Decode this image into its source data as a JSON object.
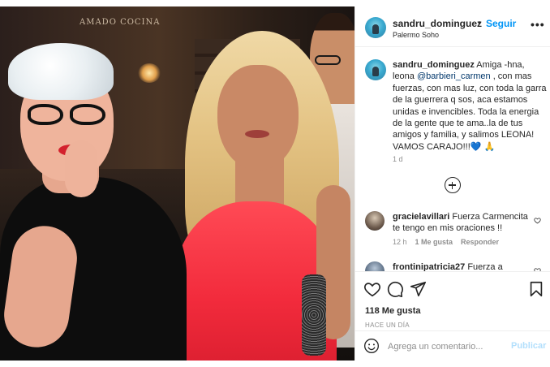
{
  "photo": {
    "sign_text": "AMADO COCINA"
  },
  "header": {
    "username": "sandru_dominguez",
    "separator": "•",
    "follow_label": "Seguir",
    "location": "Palermo Soho",
    "more_label": "•••"
  },
  "caption": {
    "username": "sandru_dominguez",
    "text_before_mention": "Amiga -hna, leona ",
    "mention": "@barbieri_carmen",
    "text_after_mention": " , con mas fuerzas, con mas luz, con toda la garra de la guerrera q sos, aca estamos unidas e invencibles. Toda la energia de la gente que te ama..la de tus amigos y familia, y salimos LEONA! VAMOS CARAJO!!!",
    "heart_emoji": "💙",
    "pray_emoji": "🙏",
    "time": "1 d"
  },
  "comments": [
    {
      "username": "gracielavillari",
      "text": "Fuerza Carmencita te tengo en mis oraciones !!",
      "time": "12 h",
      "likes": "1 Me gusta",
      "reply": "Responder"
    },
    {
      "username": "frontinipatricia27",
      "text": "Fuerza a"
    }
  ],
  "actions": {
    "likes": "118 Me gusta",
    "post_time": "HACE UN DÍA"
  },
  "add_comment": {
    "placeholder": "Agrega un comentario...",
    "publish_label": "Publicar"
  },
  "colors": {
    "accent": "#0095f6",
    "mention": "#00376b",
    "muted": "#8e8e8e",
    "publish_disabled": "#b2dffc"
  },
  "icons": [
    "more-icon",
    "load-more-icon",
    "heart-icon",
    "comment-icon",
    "share-icon",
    "save-icon",
    "emoji-icon"
  ]
}
